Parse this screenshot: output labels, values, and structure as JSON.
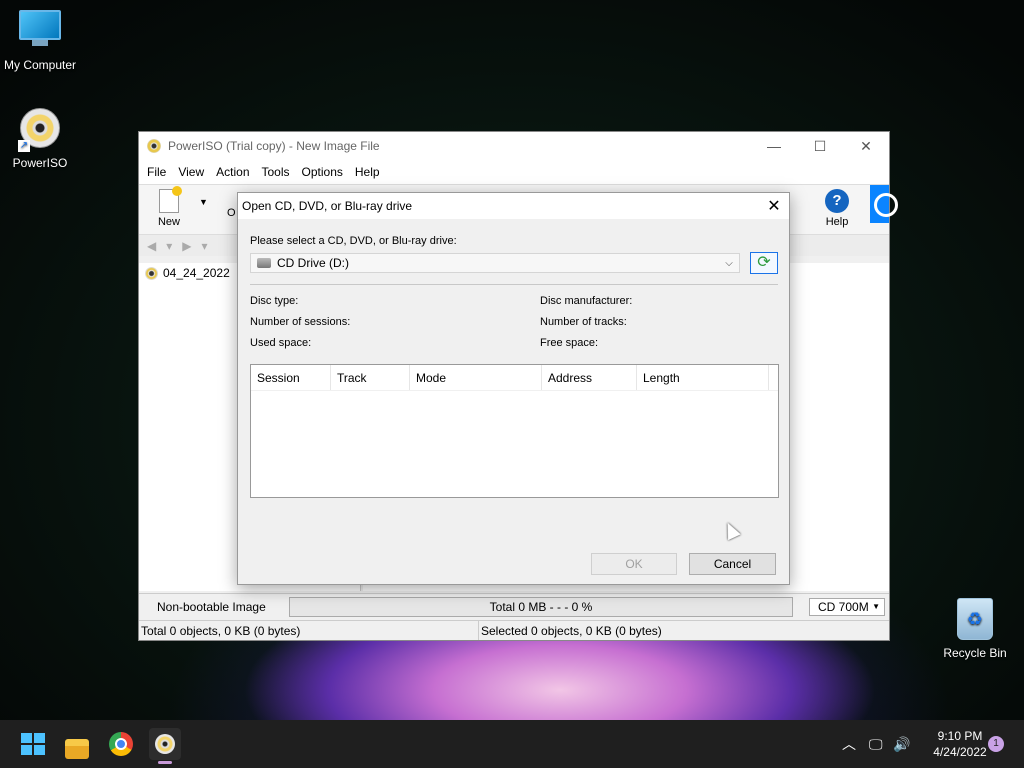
{
  "desktop": {
    "icons": [
      {
        "label": "My Computer"
      },
      {
        "label": "PowerISO"
      },
      {
        "label": "Recycle Bin"
      }
    ]
  },
  "main_window": {
    "title": "PowerISO (Trial copy) - New Image File",
    "menu": [
      "File",
      "View",
      "Action",
      "Tools",
      "Options",
      "Help"
    ],
    "toolbar": {
      "new_label": "New",
      "open_label_partial": "O",
      "help_label": "Help"
    },
    "tree": {
      "item": "04_24_2022"
    },
    "status": {
      "boot": "Non-bootable Image",
      "progress_text": "Total  0 MB   - - -  0 %",
      "media": "CD 700M",
      "total": "Total 0 objects, 0 KB (0 bytes)",
      "selected": "Selected 0 objects, 0 KB (0 bytes)"
    }
  },
  "dialog": {
    "title": "Open CD, DVD, or Blu-ray drive",
    "prompt": "Please select a CD, DVD, or Blu-ray drive:",
    "drive_selected": "CD Drive (D:)",
    "fields": {
      "disc_type": "Disc type:",
      "disc_manufacturer": "Disc manufacturer:",
      "num_sessions": "Number of sessions:",
      "num_tracks": "Number of tracks:",
      "used_space": "Used space:",
      "free_space": "Free space:"
    },
    "columns": [
      "Session",
      "Track",
      "Mode",
      "Address",
      "Length"
    ],
    "ok_label": "OK",
    "cancel_label": "Cancel"
  },
  "taskbar": {
    "time": "9:10 PM",
    "date": "4/24/2022",
    "notification_count": "1"
  }
}
